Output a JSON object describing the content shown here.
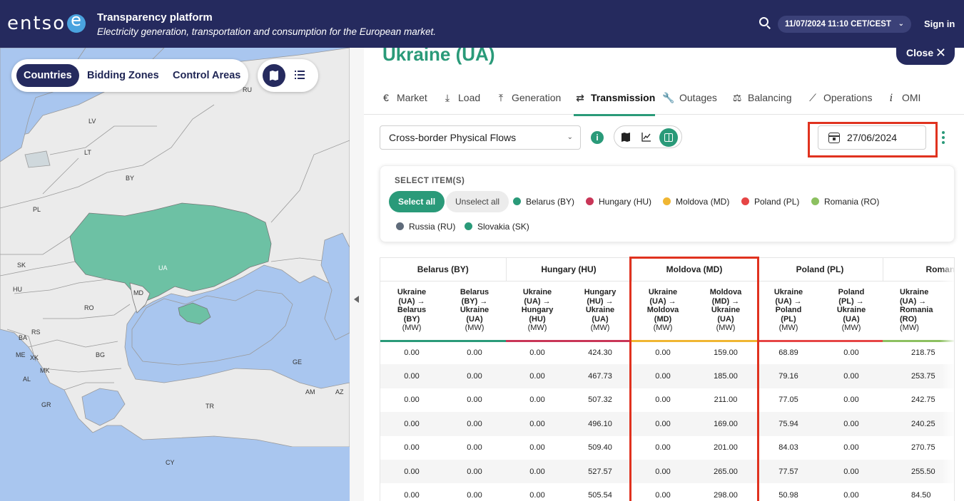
{
  "header": {
    "logo_text": "entso",
    "title": "Transparency platform",
    "subtitle": "Electricity generation, transportation and consumption for the European market.",
    "datetime": "11/07/2024 11:10 CET/CEST",
    "sign_in": "Sign in",
    "bg_color": "#252a5e"
  },
  "map": {
    "toolbar": {
      "buttons": [
        "Countries",
        "Bidding Zones",
        "Control Areas"
      ],
      "active": "Countries"
    },
    "labels": [
      "RU",
      "LV",
      "LT",
      "BY",
      "PL",
      "UA",
      "SK",
      "HU",
      "MD",
      "RO",
      "BA",
      "RS",
      "ME",
      "XK",
      "BG",
      "MK",
      "AL",
      "GE",
      "AM",
      "AZ",
      "GR",
      "TR",
      "CY"
    ],
    "colors": {
      "sea": "#a9c6ef",
      "land": "#ebebeb",
      "selected": "#6dc1a4"
    }
  },
  "panel": {
    "country_title": "Ukraine (UA)",
    "close_label": "Close",
    "tabs": [
      {
        "icon": "€",
        "label": "Market"
      },
      {
        "icon": "⤓",
        "label": "Load"
      },
      {
        "icon": "⤒",
        "label": "Generation"
      },
      {
        "icon": "⇄",
        "label": "Transmission"
      },
      {
        "icon": "🔧",
        "label": "Outages"
      },
      {
        "icon": "⚖",
        "label": "Balancing"
      },
      {
        "icon": "⟋",
        "label": "Operations"
      },
      {
        "icon": "i",
        "label": "OMI"
      }
    ],
    "active_tab": "Transmission",
    "dataset_select": "Cross-border Physical Flows",
    "date": "27/06/2024",
    "accent_color": "#2a9a79",
    "highlight_color": "#e0321f"
  },
  "select_items": {
    "heading": "SELECT ITEM(S)",
    "select_all": "Select all",
    "unselect_all": "Unselect all",
    "items": [
      {
        "label": "Belarus (BY)",
        "color": "#2a9a79"
      },
      {
        "label": "Hungary (HU)",
        "color": "#c93657"
      },
      {
        "label": "Moldova (MD)",
        "color": "#f0b632"
      },
      {
        "label": "Poland (PL)",
        "color": "#e64545"
      },
      {
        "label": "Romania (RO)",
        "color": "#8cc060"
      },
      {
        "label": "Russia (RU)",
        "color": "#5f6b7a"
      },
      {
        "label": "Slovakia (SK)",
        "color": "#2a9a79"
      }
    ]
  },
  "table": {
    "groups": [
      "Belarus (BY)",
      "Hungary (HU)",
      "Moldova (MD)",
      "Poland (PL)",
      "Romania"
    ],
    "columns": [
      [
        "Ukraine",
        "(UA) →",
        "Belarus",
        "(BY)",
        "(MW)"
      ],
      [
        "Belarus",
        "(BY) →",
        "Ukraine",
        "(UA)",
        "(MW)"
      ],
      [
        "Ukraine",
        "(UA) →",
        "Hungary",
        "(HU)",
        "(MW)"
      ],
      [
        "Hungary",
        "(HU) →",
        "Ukraine",
        "(UA)",
        "(MW)"
      ],
      [
        "Ukraine",
        "(UA) →",
        "Moldova",
        "(MD)",
        "(MW)"
      ],
      [
        "Moldova",
        "(MD) →",
        "Ukraine",
        "(UA)",
        "(MW)"
      ],
      [
        "Ukraine",
        "(UA) →",
        "Poland",
        "(PL)",
        "(MW)"
      ],
      [
        "Poland",
        "(PL) →",
        "Ukraine",
        "(UA)",
        "(MW)"
      ],
      [
        "Ukraine",
        "(UA) →",
        "Romania",
        "(RO)",
        "(MW)"
      ]
    ],
    "rows": [
      [
        "0.00",
        "0.00",
        "0.00",
        "424.30",
        "0.00",
        "159.00",
        "68.89",
        "0.00",
        "218.75"
      ],
      [
        "0.00",
        "0.00",
        "0.00",
        "467.73",
        "0.00",
        "185.00",
        "79.16",
        "0.00",
        "253.75"
      ],
      [
        "0.00",
        "0.00",
        "0.00",
        "507.32",
        "0.00",
        "211.00",
        "77.05",
        "0.00",
        "242.75"
      ],
      [
        "0.00",
        "0.00",
        "0.00",
        "496.10",
        "0.00",
        "169.00",
        "75.94",
        "0.00",
        "240.25"
      ],
      [
        "0.00",
        "0.00",
        "0.00",
        "509.40",
        "0.00",
        "201.00",
        "84.03",
        "0.00",
        "270.75"
      ],
      [
        "0.00",
        "0.00",
        "0.00",
        "527.57",
        "0.00",
        "265.00",
        "77.57",
        "0.00",
        "255.50"
      ],
      [
        "0.00",
        "0.00",
        "0.00",
        "505.54",
        "0.00",
        "298.00",
        "50.98",
        "0.00",
        "84.50"
      ]
    ]
  }
}
